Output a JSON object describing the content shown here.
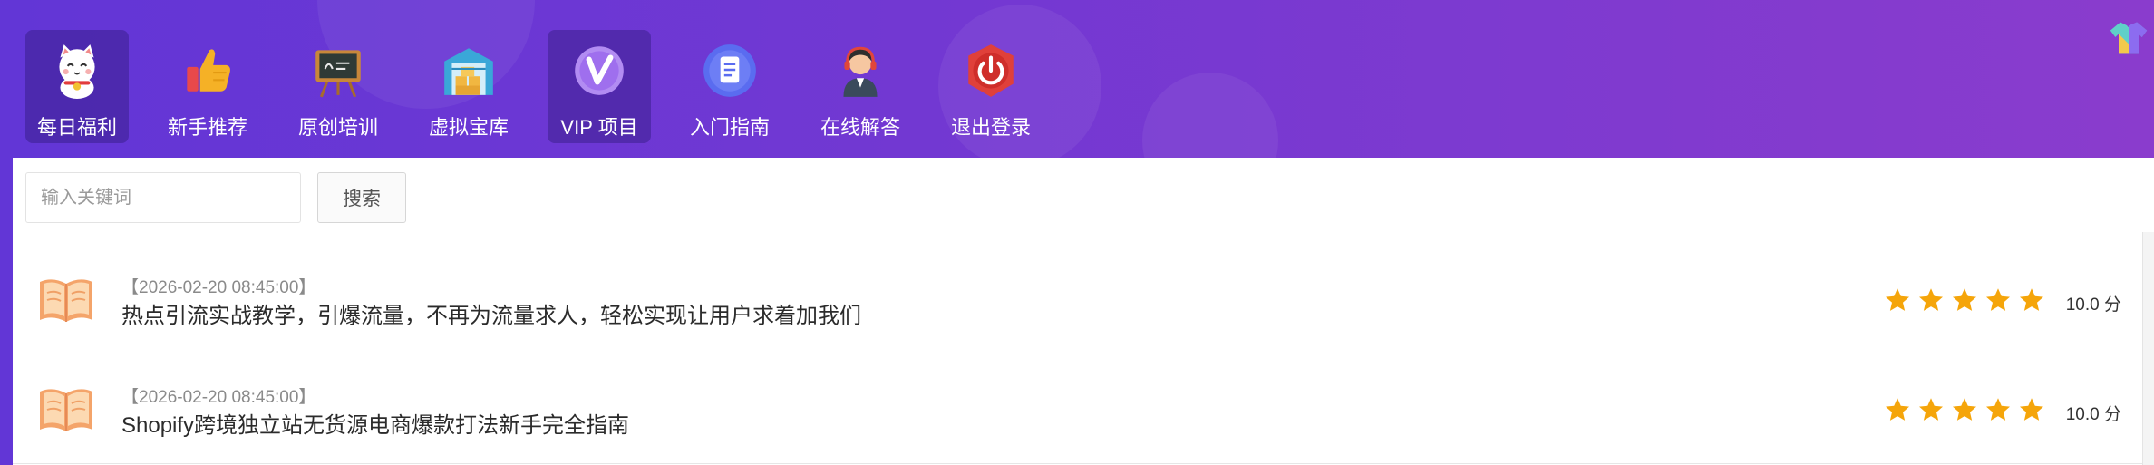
{
  "nav": {
    "items": [
      {
        "label": "每日福利",
        "icon": "lucky-cat-icon",
        "active": true
      },
      {
        "label": "新手推荐",
        "icon": "thumbs-up-icon",
        "active": false
      },
      {
        "label": "原创培训",
        "icon": "chalkboard-icon",
        "active": false
      },
      {
        "label": "虚拟宝库",
        "icon": "warehouse-icon",
        "active": false
      },
      {
        "label": "VIP 项目",
        "icon": "vip-badge-icon",
        "active": true
      },
      {
        "label": "入门指南",
        "icon": "document-icon",
        "active": false
      },
      {
        "label": "在线解答",
        "icon": "support-agent-icon",
        "active": false
      },
      {
        "label": "退出登录",
        "icon": "power-icon",
        "active": false
      }
    ]
  },
  "header": {
    "corner_icon": "tshirt-icon"
  },
  "search": {
    "placeholder": "输入关键词",
    "value": "",
    "button_label": "搜索"
  },
  "articles": [
    {
      "date": "【2026-02-20 08:45:00】",
      "title": "热点引流实战教学，引爆流量，不再为流量求人，轻松实现让用户求着加我们",
      "rating_stars": 5,
      "score": "10.0 分"
    },
    {
      "date": "【2026-02-20 08:45:00】",
      "title": "Shopify跨境独立站无货源电商爆款打法新手完全指南",
      "rating_stars": 5,
      "score": "10.0 分"
    }
  ],
  "colors": {
    "header_gradient_start": "#6236d6",
    "header_gradient_end": "#8a3ccd",
    "star": "#f5a50a",
    "book": "#f4a46a"
  }
}
